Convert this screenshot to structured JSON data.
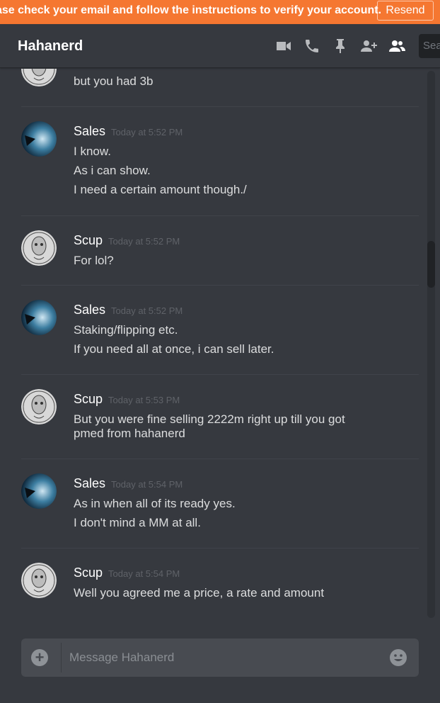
{
  "banner": {
    "text": "ase check your email and follow the instructions to verify your account.",
    "button": "Resend"
  },
  "header": {
    "title": "Hahanerd",
    "search_placeholder": "Sea"
  },
  "messages": [
    {
      "author": "",
      "timestamp": "",
      "lines": [
        "but you had 3b"
      ],
      "avatar": "scup"
    },
    {
      "author": "Sales",
      "timestamp": "Today at 5:52 PM",
      "lines": [
        "I know.",
        "As i can show.",
        "I need a certain amount though./"
      ],
      "avatar": "sales"
    },
    {
      "author": "Scup",
      "timestamp": "Today at 5:52 PM",
      "lines": [
        "For lol?"
      ],
      "avatar": "scup"
    },
    {
      "author": "Sales",
      "timestamp": "Today at 5:52 PM",
      "lines": [
        "Staking/flipping etc.",
        "If you need all at once, i can sell later."
      ],
      "avatar": "sales"
    },
    {
      "author": "Scup",
      "timestamp": "Today at 5:53 PM",
      "lines": [
        "But you were fine selling 2222m right up till you got pmed from hahanerd"
      ],
      "avatar": "scup"
    },
    {
      "author": "Sales",
      "timestamp": "Today at 5:54 PM",
      "lines": [
        "As in when all of its ready yes.",
        "I don't mind a MM at all."
      ],
      "avatar": "sales"
    },
    {
      "author": "Scup",
      "timestamp": "Today at 5:54 PM",
      "lines": [
        "Well you agreed me a price, a rate and amount"
      ],
      "avatar": "scup"
    }
  ],
  "composer": {
    "placeholder": "Message Hahanerd"
  },
  "colors": {
    "banner": "#f57731",
    "background": "#36393f",
    "composer": "#484b51"
  },
  "icons": [
    "video-call-icon",
    "voice-call-icon",
    "pin-icon",
    "add-friend-icon",
    "members-icon",
    "add-icon",
    "emoji-icon"
  ]
}
